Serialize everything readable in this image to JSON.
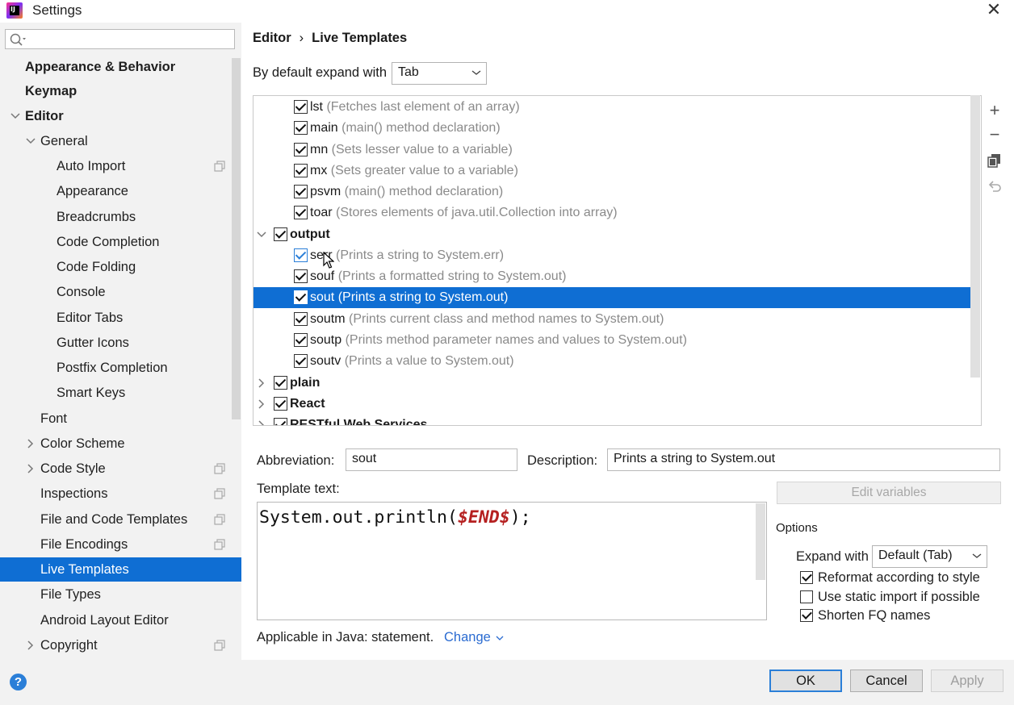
{
  "window": {
    "title": "Settings",
    "close_icon": "close-icon"
  },
  "search": {
    "placeholder": "",
    "value": ""
  },
  "sidebar": {
    "items": [
      {
        "label": "Appearance & Behavior",
        "level": 0,
        "bold": true,
        "arrow": "none"
      },
      {
        "label": "Keymap",
        "level": 0,
        "bold": true,
        "arrow": "none"
      },
      {
        "label": "Editor",
        "level": 0,
        "bold": true,
        "arrow": "down"
      },
      {
        "label": "General",
        "level": 1,
        "bold": false,
        "arrow": "down"
      },
      {
        "label": "Auto Import",
        "level": 2,
        "bold": false,
        "arrow": "none",
        "page_icon": true
      },
      {
        "label": "Appearance",
        "level": 2,
        "bold": false,
        "arrow": "none"
      },
      {
        "label": "Breadcrumbs",
        "level": 2,
        "bold": false,
        "arrow": "none"
      },
      {
        "label": "Code Completion",
        "level": 2,
        "bold": false,
        "arrow": "none"
      },
      {
        "label": "Code Folding",
        "level": 2,
        "bold": false,
        "arrow": "none"
      },
      {
        "label": "Console",
        "level": 2,
        "bold": false,
        "arrow": "none"
      },
      {
        "label": "Editor Tabs",
        "level": 2,
        "bold": false,
        "arrow": "none"
      },
      {
        "label": "Gutter Icons",
        "level": 2,
        "bold": false,
        "arrow": "none"
      },
      {
        "label": "Postfix Completion",
        "level": 2,
        "bold": false,
        "arrow": "none"
      },
      {
        "label": "Smart Keys",
        "level": 2,
        "bold": false,
        "arrow": "none"
      },
      {
        "label": "Font",
        "level": 1,
        "bold": false,
        "arrow": "none"
      },
      {
        "label": "Color Scheme",
        "level": 1,
        "bold": false,
        "arrow": "right"
      },
      {
        "label": "Code Style",
        "level": 1,
        "bold": false,
        "arrow": "right",
        "page_icon": true
      },
      {
        "label": "Inspections",
        "level": 1,
        "bold": false,
        "arrow": "none",
        "page_icon": true
      },
      {
        "label": "File and Code Templates",
        "level": 1,
        "bold": false,
        "arrow": "none",
        "page_icon": true
      },
      {
        "label": "File Encodings",
        "level": 1,
        "bold": false,
        "arrow": "none",
        "page_icon": true
      },
      {
        "label": "Live Templates",
        "level": 1,
        "bold": false,
        "arrow": "none",
        "selected": true
      },
      {
        "label": "File Types",
        "level": 1,
        "bold": false,
        "arrow": "none"
      },
      {
        "label": "Android Layout Editor",
        "level": 1,
        "bold": false,
        "arrow": "none"
      },
      {
        "label": "Copyright",
        "level": 1,
        "bold": false,
        "arrow": "right",
        "page_icon": true
      }
    ]
  },
  "breadcrumb": {
    "parent": "Editor",
    "separator": "›",
    "current": "Live Templates"
  },
  "expand_default": {
    "label": "By default expand with",
    "value": "Tab"
  },
  "templates": [
    {
      "abbr": "lst",
      "desc": "(Fetches last element of an array)",
      "checked": true,
      "type": "item"
    },
    {
      "abbr": "main",
      "desc": "(main() method declaration)",
      "checked": true,
      "type": "item"
    },
    {
      "abbr": "mn",
      "desc": "(Sets lesser value to a variable)",
      "checked": true,
      "type": "item"
    },
    {
      "abbr": "mx",
      "desc": "(Sets greater value to a variable)",
      "checked": true,
      "type": "item"
    },
    {
      "abbr": "psvm",
      "desc": "(main() method declaration)",
      "checked": true,
      "type": "item"
    },
    {
      "abbr": "toar",
      "desc": "(Stores elements of java.util.Collection into array)",
      "checked": true,
      "type": "item"
    },
    {
      "abbr": "output",
      "desc": "",
      "checked": true,
      "type": "group",
      "expanded": true
    },
    {
      "abbr": "serr",
      "desc": "(Prints a string to System.err)",
      "checked": true,
      "type": "item",
      "hover": true
    },
    {
      "abbr": "souf",
      "desc": "(Prints a formatted string to System.out)",
      "checked": true,
      "type": "item"
    },
    {
      "abbr": "sout",
      "desc": "(Prints a string to System.out)",
      "checked": true,
      "type": "item",
      "selected": true
    },
    {
      "abbr": "soutm",
      "desc": "(Prints current class and method names to System.out)",
      "checked": true,
      "type": "item"
    },
    {
      "abbr": "soutp",
      "desc": "(Prints method parameter names and values to System.out)",
      "checked": true,
      "type": "item"
    },
    {
      "abbr": "soutv",
      "desc": "(Prints a value to System.out)",
      "checked": true,
      "type": "item"
    },
    {
      "abbr": "plain",
      "desc": "",
      "checked": true,
      "type": "group",
      "expanded": false
    },
    {
      "abbr": "React",
      "desc": "",
      "checked": true,
      "type": "group",
      "expanded": false
    },
    {
      "abbr": "RESTful Web Services",
      "desc": "",
      "checked": true,
      "type": "group",
      "expanded": false
    }
  ],
  "tools": {
    "add": "+",
    "remove": "−"
  },
  "details": {
    "abbreviation_label": "Abbreviation:",
    "abbreviation_value": "sout",
    "description_label": "Description:",
    "description_value": "Prints a string to System.out",
    "template_text_label": "Template text:",
    "template_code_prefix": "System.out.println(",
    "template_code_var": "$END$",
    "template_code_suffix": ");",
    "edit_variables": "Edit variables",
    "applicable": "Applicable in Java: statement.",
    "change": "Change"
  },
  "options": {
    "title": "Options",
    "expand_with_label": "Expand with",
    "expand_with_value": "Default (Tab)",
    "reformat": {
      "label": "Reformat according to style",
      "checked": true
    },
    "static_import": {
      "label": "Use static import if possible",
      "checked": false
    },
    "shorten_fq": {
      "label": "Shorten FQ names",
      "checked": true
    }
  },
  "buttons": {
    "ok": "OK",
    "cancel": "Cancel",
    "apply": "Apply",
    "help": "?"
  },
  "colors": {
    "selection": "#0f6ed3",
    "link": "#2a6bd1",
    "template_var": "#b52020",
    "sidebar_bg": "#f2f2f2"
  }
}
